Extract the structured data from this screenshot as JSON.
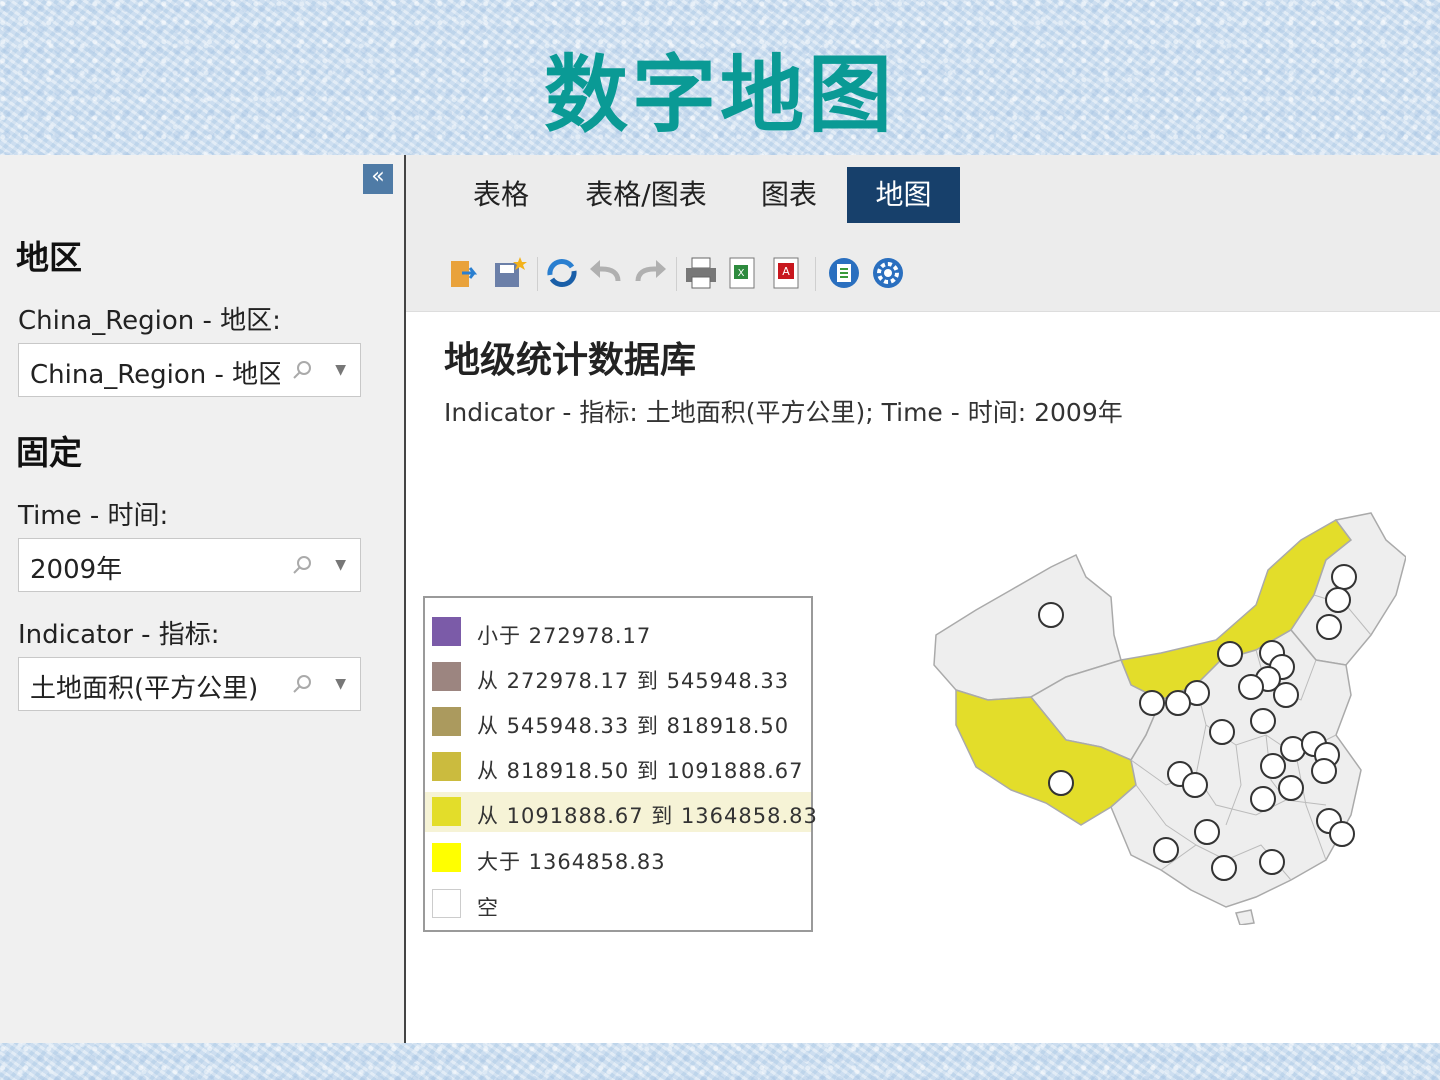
{
  "slide": {
    "title": "数字地图"
  },
  "sidebar": {
    "collapse_icon": "double-chevron-left-icon",
    "region_heading": "地区",
    "region_label": "China_Region - 地区:",
    "region_value": "China_Region - 地区...",
    "fixed_heading": "固定",
    "time_label": "Time - 时间:",
    "time_value": "2009年",
    "indicator_label": "Indicator - 指标:",
    "indicator_value": "土地面积(平方公里)"
  },
  "tabs": [
    {
      "label": "表格",
      "active": false
    },
    {
      "label": "表格/图表",
      "active": false
    },
    {
      "label": "图表",
      "active": false
    },
    {
      "label": "地图",
      "active": true
    }
  ],
  "toolbar": {
    "icons": [
      "open-folder-icon",
      "save-new-icon",
      "refresh-icon",
      "undo-icon",
      "redo-icon",
      "print-icon",
      "excel-export-icon",
      "pdf-export-icon",
      "info-icon",
      "settings-icon"
    ]
  },
  "report": {
    "title": "地级统计数据库",
    "subtitle": "Indicator - 指标: 土地面积(平方公里); Time - 时间: 2009年"
  },
  "legend": [
    {
      "label": "小于 272978.17",
      "color": "#7b5ba8"
    },
    {
      "label": "从 272978.17 到 545948.33",
      "color": "#9c8580"
    },
    {
      "label": "从 545948.33 到 818918.50",
      "color": "#ab9a5e"
    },
    {
      "label": "从 818918.50 到 1091888.67",
      "color": "#cbbb3e"
    },
    {
      "label": "从 1091888.67 到 1364858.83",
      "color": "#e3dd2a",
      "highlighted": true
    },
    {
      "label": "大于 1364858.83",
      "color": "#ffff00"
    },
    {
      "label": "空",
      "color": "#ffffff"
    }
  ],
  "map_regions": [
    {
      "region": "Xinjiang",
      "class": "空",
      "fill": "#eeeeee"
    },
    {
      "region": "Tibet",
      "class": "从 1091888.67 到 1364858.83",
      "fill": "#e3dd2a"
    },
    {
      "region": "Inner Mongolia",
      "class": "从 1091888.67 到 1364858.83",
      "fill": "#e3dd2a"
    },
    {
      "region": "Other provinces",
      "class": "空",
      "fill": "#eeeeee"
    }
  ]
}
